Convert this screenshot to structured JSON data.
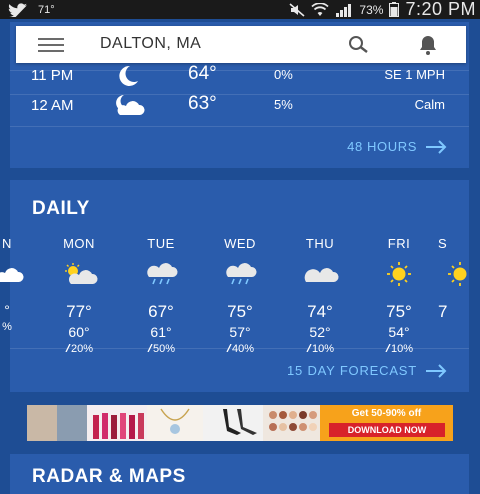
{
  "status_bar": {
    "temperature": "71°",
    "battery_percent": "73%",
    "time": "7:20 PM"
  },
  "search_bar": {
    "location": "DALTON, MA",
    "icons": [
      "menu-icon",
      "search-icon",
      "bell-icon"
    ]
  },
  "hourly": {
    "rows": [
      {
        "time": "11 PM",
        "icon": "moon-clear-icon",
        "temp": "64°",
        "precip": "0%",
        "wind": "SE 1 MPH"
      },
      {
        "time": "12 AM",
        "icon": "moon-cloud-icon",
        "temp": "63°",
        "precip": "5%",
        "wind": "Calm"
      }
    ],
    "link_label": "48 HOURS"
  },
  "daily": {
    "title": "DAILY",
    "days": [
      {
        "name": "N",
        "icon": "partly-cloudy-icon",
        "hi": "",
        "lo": "°",
        "precip": "%"
      },
      {
        "name": "MON",
        "icon": "partly-cloudy-icon",
        "hi": "77°",
        "lo": "60°",
        "precip": "20%"
      },
      {
        "name": "TUE",
        "icon": "rain-cloud-icon",
        "hi": "67°",
        "lo": "61°",
        "precip": "50%"
      },
      {
        "name": "WED",
        "icon": "rain-cloud-icon",
        "hi": "75°",
        "lo": "57°",
        "precip": "40%"
      },
      {
        "name": "THU",
        "icon": "cloud-icon",
        "hi": "74°",
        "lo": "52°",
        "precip": "10%"
      },
      {
        "name": "FRI",
        "icon": "sun-icon",
        "hi": "75°",
        "lo": "54°",
        "precip": "10%"
      },
      {
        "name": "S",
        "icon": "sun-icon",
        "hi": "7",
        "lo": "",
        "precip": ""
      }
    ],
    "link_label": "15 DAY FORECAST"
  },
  "ad": {
    "line1": "Get 50-90% off",
    "button": "DOWNLOAD NOW"
  },
  "radar": {
    "title": "RADAR & MAPS"
  },
  "colors": {
    "background": "#1e4d94",
    "card": "#2a5cac",
    "link": "#7fc8ff",
    "sun": "#ffd21f",
    "ad_orange": "#f7a21b",
    "ad_red": "#d8222a"
  }
}
